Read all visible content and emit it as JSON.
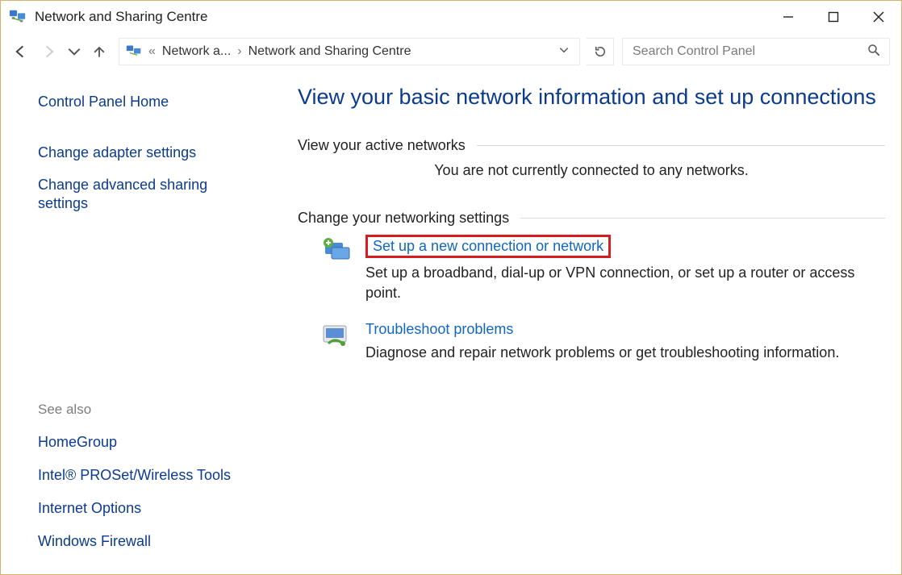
{
  "window": {
    "title": "Network and Sharing Centre"
  },
  "breadcrumb": {
    "item1": "Network a...",
    "item2": "Network and Sharing Centre"
  },
  "search": {
    "placeholder": "Search Control Panel"
  },
  "sidebar": {
    "control_panel_home": "Control Panel Home",
    "change_adapter": "Change adapter settings",
    "change_advanced": "Change advanced sharing settings",
    "see_also": "See also",
    "homegroup": "HomeGroup",
    "intel_proset": "Intel® PROSet/Wireless Tools",
    "internet_options": "Internet Options",
    "windows_firewall": "Windows Firewall"
  },
  "main": {
    "title": "View your basic network information and set up connections",
    "active_heading": "View your active networks",
    "active_status": "You are not currently connected to any networks.",
    "change_heading": "Change your networking settings",
    "option1_link": "Set up a new connection or network",
    "option1_desc": "Set up a broadband, dial-up or VPN connection, or set up a router or access point.",
    "option2_link": "Troubleshoot problems",
    "option2_desc": "Diagnose and repair network problems or get troubleshooting information."
  }
}
